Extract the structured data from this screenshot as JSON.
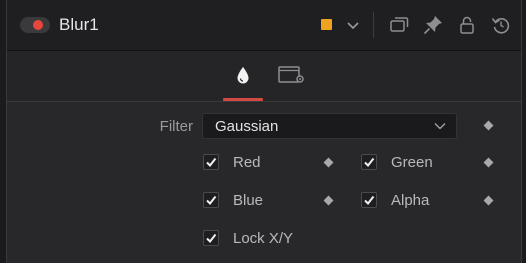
{
  "header": {
    "title": "Blur1",
    "icons": [
      "power-toggle",
      "color-chip",
      "chevron-down-icon",
      "duplicate-icon",
      "pin-icon",
      "lock-icon",
      "reset-icon"
    ],
    "accent_color": "#f0a320",
    "toggle_color": "#e8463c"
  },
  "tabs": [
    {
      "name": "settings-tab-drop",
      "icon": "droplet-icon",
      "active": true
    },
    {
      "name": "settings-tab-config",
      "icon": "settings-window-icon",
      "active": false
    }
  ],
  "filter": {
    "label": "Filter",
    "value": "Gaussian"
  },
  "channels": [
    {
      "label": "Red",
      "checked": true
    },
    {
      "label": "Green",
      "checked": true
    },
    {
      "label": "Blue",
      "checked": true
    },
    {
      "label": "Alpha",
      "checked": true
    }
  ],
  "lock": {
    "label": "Lock X/Y",
    "checked": true
  }
}
